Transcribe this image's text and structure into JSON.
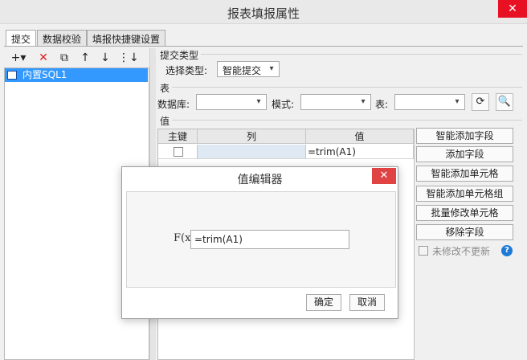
{
  "window": {
    "title": "报表填报属性",
    "close": "✕"
  },
  "tabs": [
    {
      "label": "提交",
      "active": true
    },
    {
      "label": "数据校验",
      "active": false
    },
    {
      "label": "填报快捷键设置",
      "active": false
    }
  ],
  "left_toolbar": {
    "add": "+▾",
    "delete": "✕",
    "copy": "⧉",
    "up": "↑",
    "down": "↓",
    "more": "⋮↓"
  },
  "left_list": {
    "items": [
      "内置SQL1"
    ]
  },
  "submit_type": {
    "title": "提交类型",
    "label": "选择类型:",
    "value": "智能提交"
  },
  "table_section": {
    "title": "表",
    "db_label": "数据库:",
    "mode_label": "模式:",
    "table_label": "表:"
  },
  "value_section": {
    "title": "值",
    "headers": [
      "主键",
      "列",
      "值"
    ],
    "rows": [
      {
        "key": "",
        "column": "",
        "value": "=trim(A1)"
      }
    ]
  },
  "right_buttons": [
    "智能添加字段",
    "添加字段",
    "智能添加单元格",
    "智能添加单元格组",
    "批量修改单元格",
    "移除字段"
  ],
  "unchanged_option": {
    "label": "未修改不更新",
    "checked": false
  },
  "help_icon": "?",
  "dialog": {
    "title": "值编辑器",
    "close": "✕",
    "fx_label": "F(x)",
    "input_value": "=trim(A1)",
    "ok": "确定",
    "cancel": "取消"
  },
  "colors": {
    "selection": "#3399ff",
    "close_red": "#e81123",
    "help_blue": "#1e7ad6"
  }
}
